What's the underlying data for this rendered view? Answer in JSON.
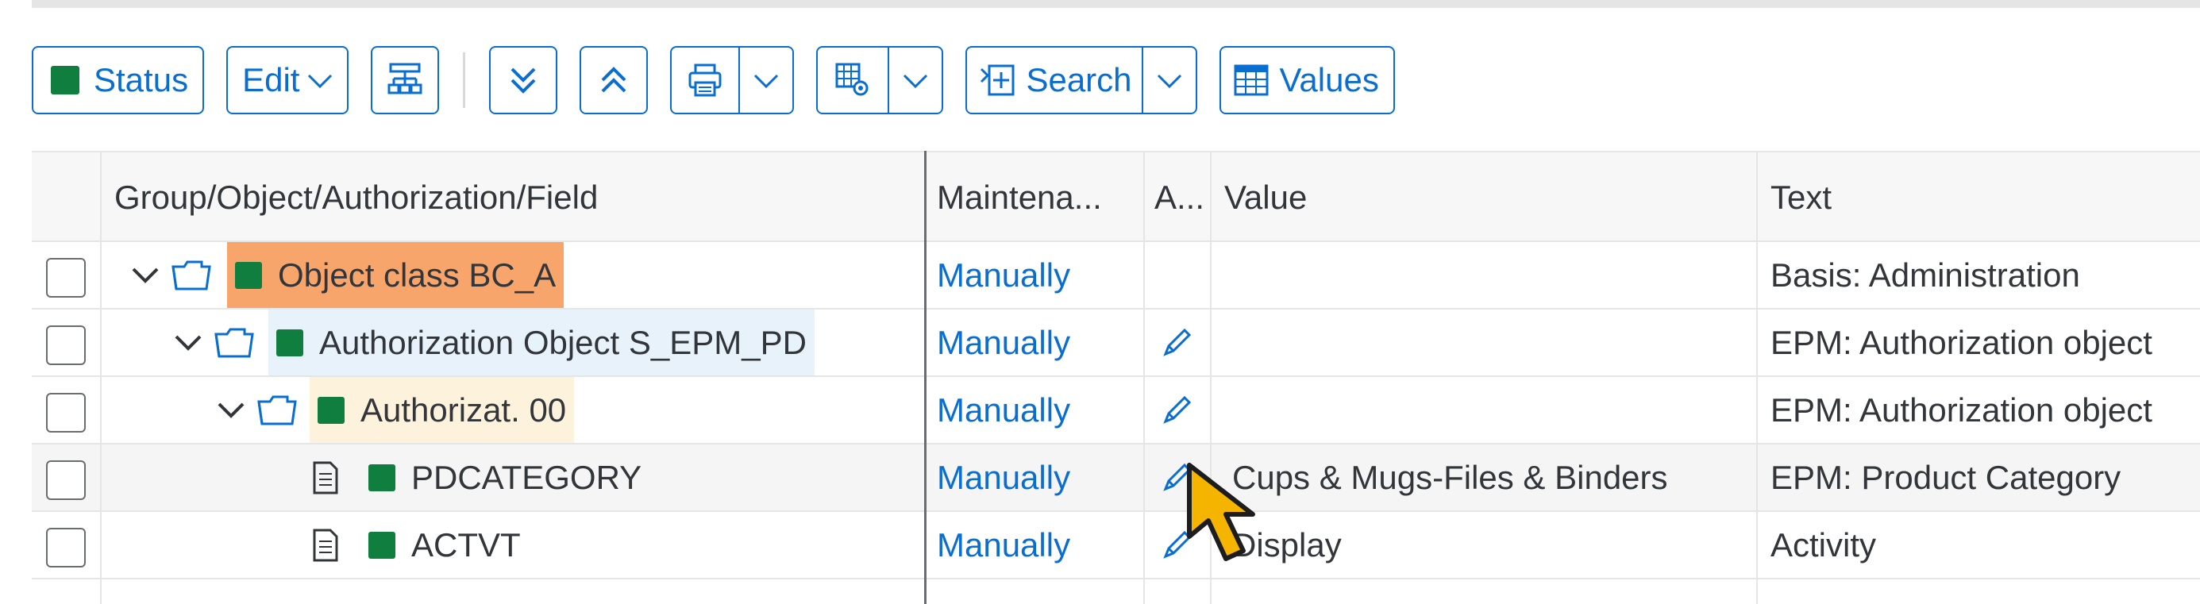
{
  "toolbar": {
    "status_label": "Status",
    "edit_label": "Edit",
    "search_label": "Search",
    "values_label": "Values",
    "status_color": "#107e3e",
    "accent": "#0a6ed1"
  },
  "table": {
    "headers": {
      "name": "Group/Object/Authorization/Field",
      "maintenance": "Maintena...",
      "a": "A...",
      "value": "Value",
      "text": "Text"
    },
    "rows": [
      {
        "name": "Object class BC_A",
        "maintenance": "Manually",
        "value": "",
        "text": "Basis: Administration"
      },
      {
        "name": "Authorization Object S_EPM_PD",
        "maintenance": "Manually",
        "value": "",
        "text": "EPM: Authorization object"
      },
      {
        "name": "Authorizat. 00",
        "maintenance": "Manually",
        "value": "",
        "text": "EPM: Authorization object"
      },
      {
        "name": "PDCATEGORY",
        "maintenance": "Manually",
        "value": "Cups & Mugs-Files & Binders",
        "text": "EPM: Product Category"
      },
      {
        "name": "ACTVT",
        "maintenance": "Manually",
        "value": "Display",
        "text": "Activity"
      }
    ]
  },
  "icons": [
    "chevron-down-icon",
    "folder-icon",
    "document-icon",
    "pencil-icon",
    "print-icon",
    "settings-icon",
    "collapse-all-icon",
    "expand-all-icon",
    "hierarchy-icon",
    "values-table-icon",
    "search-icon"
  ]
}
